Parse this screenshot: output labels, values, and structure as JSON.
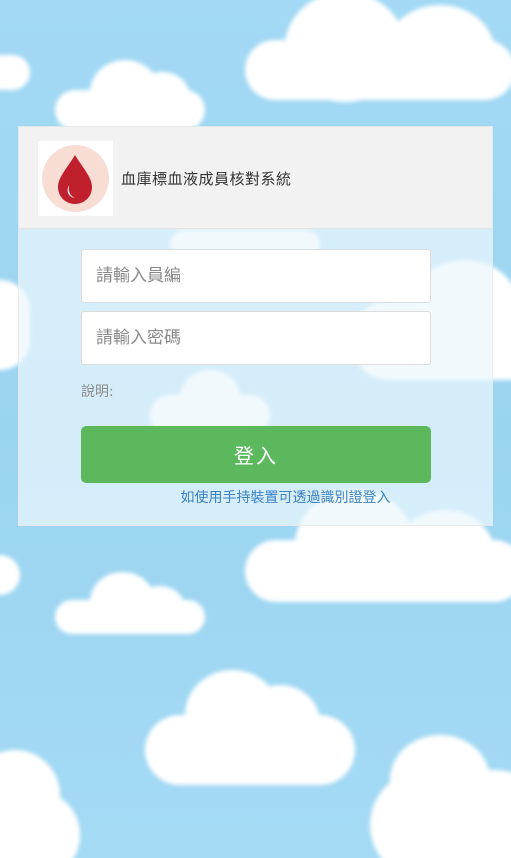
{
  "header": {
    "title": "血庫標血液成員核對系統"
  },
  "form": {
    "username_placeholder": "請輸入員編",
    "password_placeholder": "請輸入密碼",
    "hint_label": "說明:",
    "login_label": "登入",
    "qr_link_text": "如使用手持裝置可透過識別證登入"
  },
  "colors": {
    "login_button": "#5cb85c",
    "link": "#3b82c4",
    "logo_drop": "#c0202e",
    "logo_bg": "#f8ddd5",
    "sky": "#9dd6f2"
  },
  "icons": {
    "logo": "blood-drop-icon"
  }
}
